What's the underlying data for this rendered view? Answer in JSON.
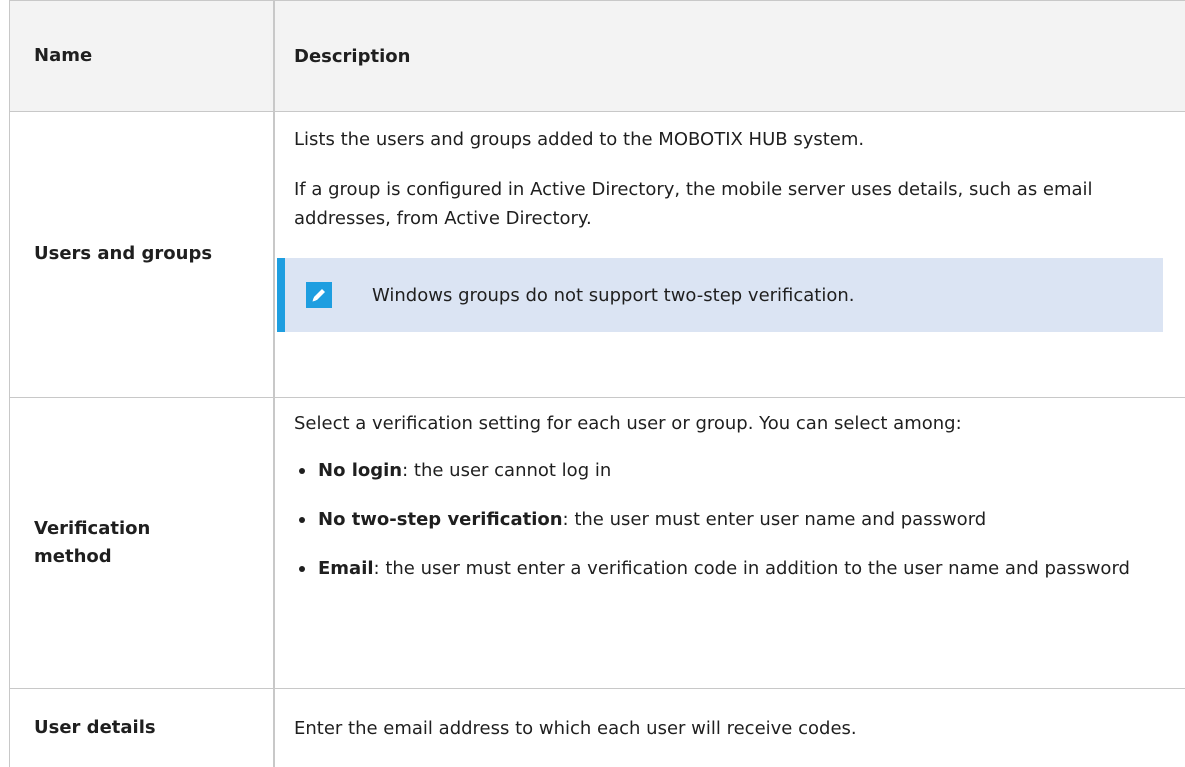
{
  "table": {
    "header": {
      "name": "Name",
      "description": "Description"
    },
    "rows": [
      {
        "name": "Users and groups",
        "paragraphs": [
          "Lists the users and groups added to the MOBOTIX HUB system.",
          "If a group is configured in Active Directory, the mobile server uses details, such as email addresses, from Active Directory."
        ],
        "note": {
          "icon": "pencil-icon",
          "text": "Windows groups do not support two-step verification."
        }
      },
      {
        "name": "Verification method",
        "intro": "Select a verification setting for each user or group. You can select among:",
        "options": [
          {
            "term": "No login",
            "text": ": the user cannot log in"
          },
          {
            "term": "No two-step verification",
            "text": ": the user must enter user name and password"
          },
          {
            "term": "Email",
            "text": ": the user must enter a verification code in addition to the user name and password"
          }
        ]
      },
      {
        "name": "User details",
        "description": "Enter the email address to which each user will receive codes."
      }
    ]
  },
  "colors": {
    "border": "#c8c8c8",
    "header_bg": "#f3f3f3",
    "note_bg": "#dbe4f3",
    "accent": "#1e9ee0"
  }
}
